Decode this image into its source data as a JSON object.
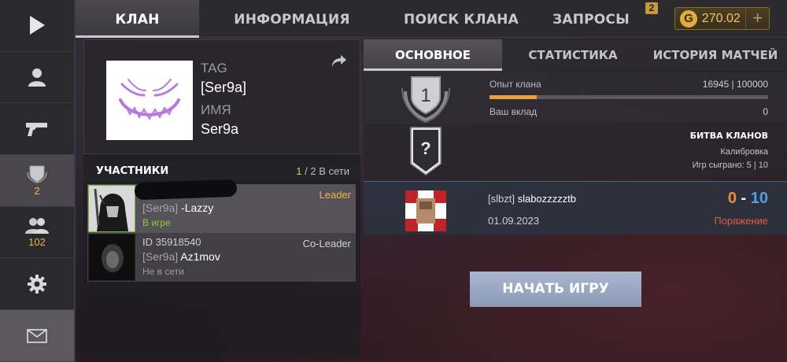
{
  "sidebar": {
    "items": [
      {
        "icon": "play-icon"
      },
      {
        "icon": "profile-icon"
      },
      {
        "icon": "pistol-icon"
      },
      {
        "icon": "clan-shield-icon",
        "count": "2"
      },
      {
        "icon": "friends-icon",
        "count": "102"
      },
      {
        "icon": "gear-icon"
      },
      {
        "icon": "mail-icon"
      }
    ]
  },
  "top_tabs": {
    "clan": "КЛАН",
    "info": "ИНФОРМАЦИЯ",
    "search": "ПОИСК КЛАНА",
    "requests": "ЗАПРОСЫ",
    "requests_badge": "2"
  },
  "currency": {
    "icon": "G",
    "amount": "270.02",
    "add": "+"
  },
  "clan": {
    "tag_label": "TAG",
    "tag_value": "[Ser9a]",
    "name_label": "ИМЯ",
    "name_value": "Ser9a"
  },
  "members": {
    "title": "УЧАСТНИКИ",
    "online_count": "1",
    "online_total": "/ 2 В сети",
    "list": [
      {
        "id": "",
        "tag": "[Ser9a]",
        "name": " -Lazzy",
        "status": "В игре",
        "role": "Leader",
        "status_color": "#8fce3a",
        "role_color": "#e7b84a"
      },
      {
        "id": "ID 35918540",
        "tag": "[Ser9a]",
        "name": " Az1mov",
        "status": "Не в сети",
        "role": "Co-Leader",
        "status_color": "#9c9aa2",
        "role_color": "#d0d0d4"
      }
    ]
  },
  "sub_tabs": {
    "main": "ОСНОВНОЕ",
    "stats": "СТАТИСТИКА",
    "history": "ИСТОРИЯ МАТЧЕЙ"
  },
  "experience": {
    "rank": "1",
    "label": "Опыт клана",
    "value": "16945 | 100000",
    "progress": 0.16945,
    "contribution_label": "Ваш вклад",
    "contribution_value": "0"
  },
  "battle": {
    "rank": "?",
    "title": "БИТВА КЛАНОВ",
    "mode": "Калибровка",
    "games": "Игр сыграно: 5 | 10"
  },
  "match": {
    "opponent_tag": "[slbzt]",
    "opponent_name": " slabozzzzztb",
    "date": "01.09.2023",
    "score_own": "0",
    "score_sep": " - ",
    "score_opp": "10",
    "result": "Поражение"
  },
  "play_button": "НАЧАТЬ ИГРУ"
}
